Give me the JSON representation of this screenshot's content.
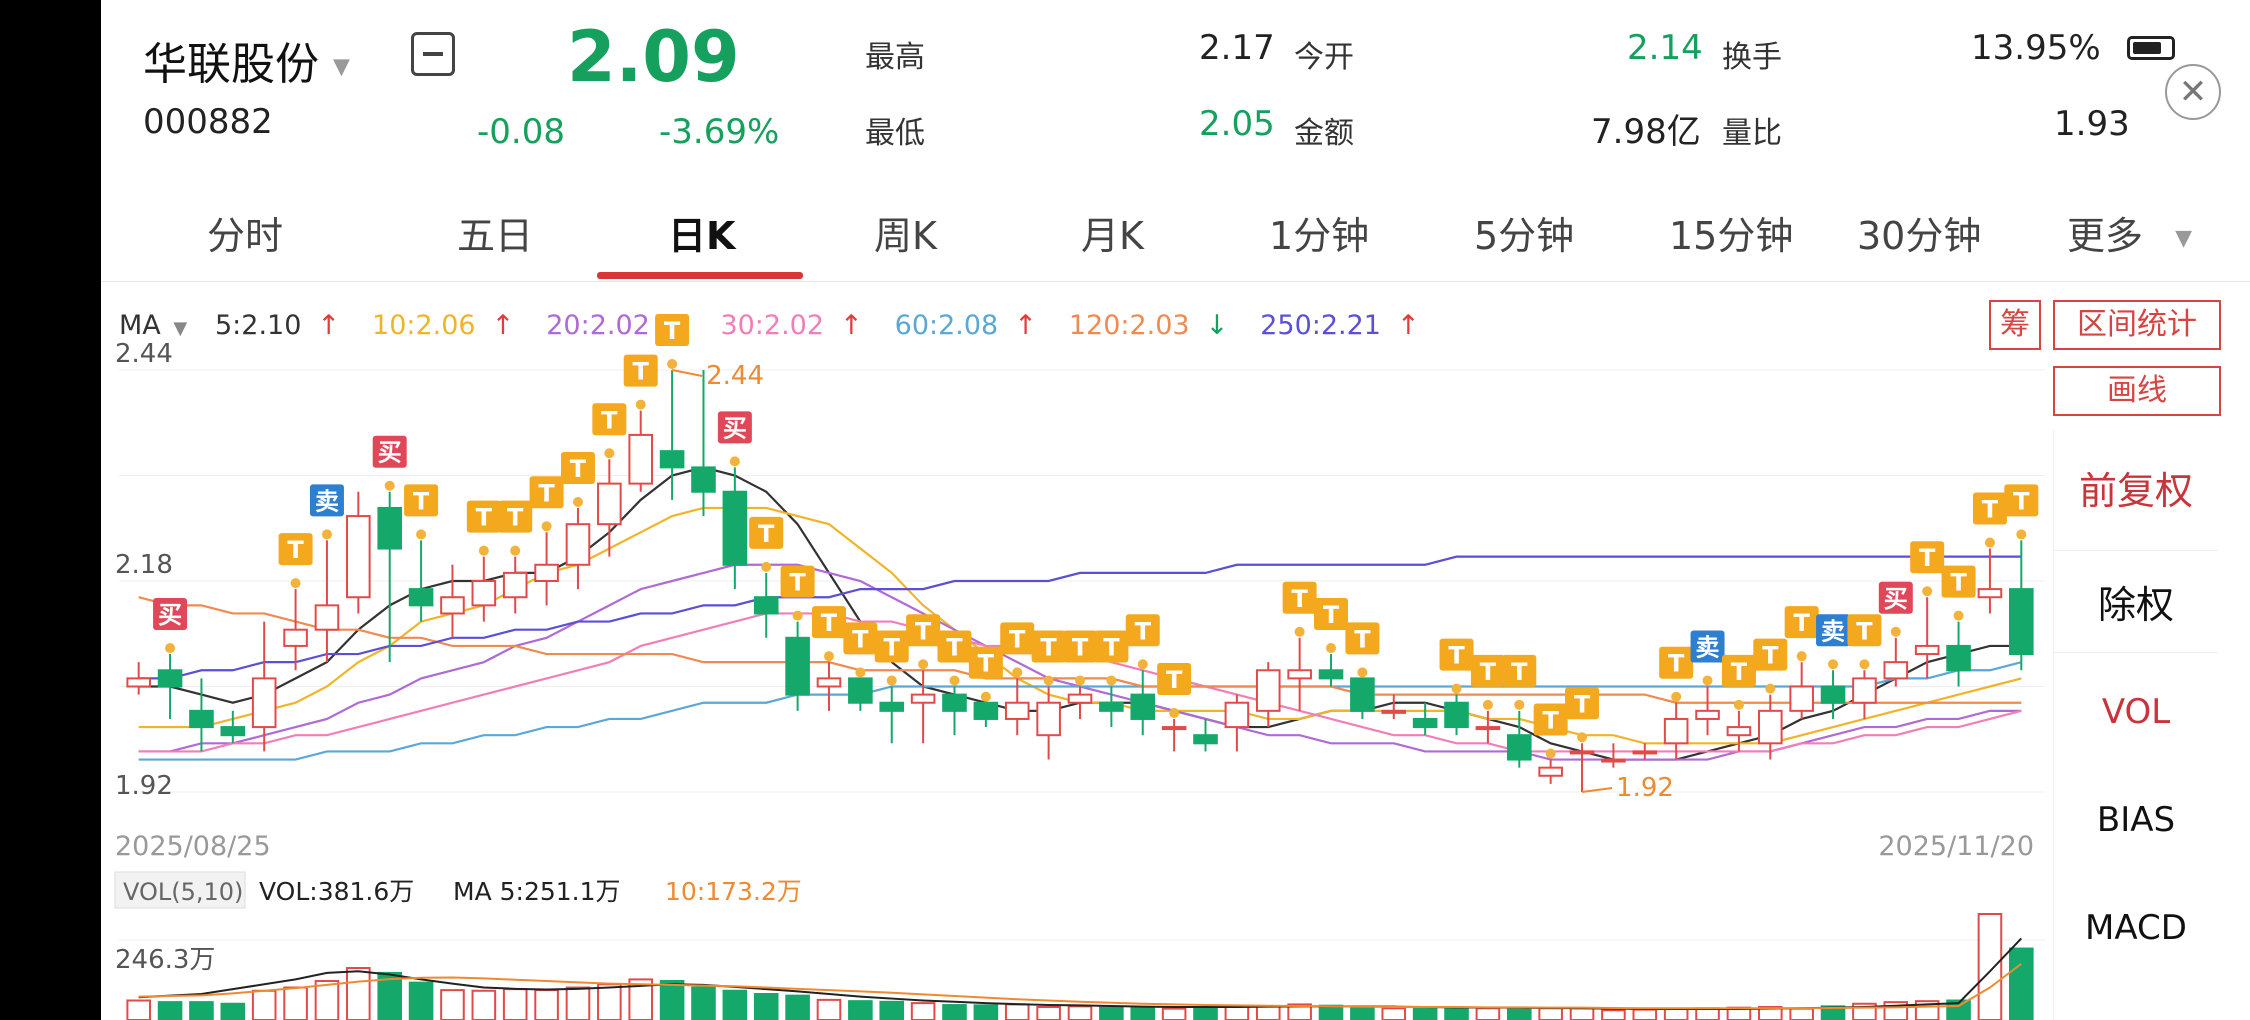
{
  "status": {
    "battery": "13.95%"
  },
  "header": {
    "stock_name": "华联股份",
    "stock_code": "000882",
    "price": "2.09",
    "change": "-0.08",
    "change_pct": "-3.69%",
    "stats": [
      {
        "label": "最高",
        "value": "2.17"
      },
      {
        "label": "今开",
        "value": "2.14"
      },
      {
        "label": "换手",
        "value": "13.95%"
      },
      {
        "label": "最低",
        "value": "2.05"
      },
      {
        "label": "金额",
        "value": "7.98亿"
      },
      {
        "label": "量比",
        "value": "1.93"
      }
    ]
  },
  "tabs": [
    "分时",
    "五日",
    "日K",
    "周K",
    "月K",
    "1分钟",
    "5分钟",
    "15分钟",
    "30分钟",
    "更多"
  ],
  "active_tab": "日K",
  "ma_legend": {
    "title": "MA",
    "items": [
      {
        "text": "5:2.10",
        "arrow": "↑",
        "color": "#333333"
      },
      {
        "text": "10:2.06",
        "arrow": "↑",
        "color": "#f0b429"
      },
      {
        "text": "20:2.02",
        "arrow": "↑",
        "color": "#b06ad6"
      },
      {
        "text": "30:2.02",
        "arrow": "↑",
        "color": "#f07fb8"
      },
      {
        "text": "60:2.08",
        "arrow": "↑",
        "color": "#5aa7d8"
      },
      {
        "text": "120:2.03",
        "arrow": "↓",
        "color": "#ef8a50"
      },
      {
        "text": "250:2.21",
        "arrow": "↑",
        "color": "#5a4fd6"
      }
    ]
  },
  "side_panel": {
    "chip_button": "筹",
    "range_stats_button": "区间统计",
    "draw_button": "画线",
    "items": [
      "前复权",
      "除权",
      "VOL",
      "BIAS",
      "MACD"
    ]
  },
  "chart": {
    "y_labels": [
      "2.44",
      "2.18",
      "1.92"
    ],
    "high_marker": "2.44",
    "low_marker": "1.92",
    "x_start": "2025/08/25",
    "x_end": "2025/11/20",
    "vol_title": "VOL(5,10)",
    "vol_values": [
      {
        "text": "VOL:381.6万",
        "color": "#222222"
      },
      {
        "text": "MA 5:251.1万",
        "color": "#222222"
      },
      {
        "text": "10:173.2万",
        "color": "#ef8a30"
      }
    ],
    "vol_axis": "246.3万",
    "buy_label": "买",
    "sell_label": "卖",
    "t_label": "T"
  },
  "chart_data": {
    "type": "candlestick",
    "ylim": [
      1.92,
      2.44
    ],
    "start_date": "2025/08/25",
    "end_date": "2025/11/20",
    "candles": [
      [
        2.05,
        2.06,
        2.08,
        2.04
      ],
      [
        2.07,
        2.05,
        2.09,
        2.01
      ],
      [
        2.02,
        2.0,
        2.06,
        1.97
      ],
      [
        2.0,
        1.99,
        2.02,
        1.98
      ],
      [
        2.0,
        2.06,
        2.13,
        1.97
      ],
      [
        2.1,
        2.12,
        2.17,
        2.07
      ],
      [
        2.12,
        2.15,
        2.23,
        2.08
      ],
      [
        2.16,
        2.26,
        2.29,
        2.14
      ],
      [
        2.27,
        2.22,
        2.29,
        2.08
      ],
      [
        2.17,
        2.15,
        2.23,
        2.13
      ],
      [
        2.14,
        2.16,
        2.2,
        2.11
      ],
      [
        2.15,
        2.18,
        2.21,
        2.13
      ],
      [
        2.16,
        2.19,
        2.21,
        2.14
      ],
      [
        2.18,
        2.2,
        2.24,
        2.15
      ],
      [
        2.2,
        2.25,
        2.27,
        2.17
      ],
      [
        2.25,
        2.3,
        2.33,
        2.21
      ],
      [
        2.3,
        2.36,
        2.39,
        2.29
      ],
      [
        2.34,
        2.32,
        2.44,
        2.28
      ],
      [
        2.32,
        2.29,
        2.44,
        2.26
      ],
      [
        2.29,
        2.2,
        2.32,
        2.17
      ],
      [
        2.16,
        2.14,
        2.19,
        2.11
      ],
      [
        2.11,
        2.04,
        2.13,
        2.02
      ],
      [
        2.05,
        2.06,
        2.08,
        2.02
      ],
      [
        2.06,
        2.03,
        2.06,
        2.02
      ],
      [
        2.03,
        2.02,
        2.05,
        1.98
      ],
      [
        2.03,
        2.04,
        2.07,
        1.98
      ],
      [
        2.04,
        2.02,
        2.05,
        1.99
      ],
      [
        2.03,
        2.01,
        2.03,
        2.0
      ],
      [
        2.01,
        2.03,
        2.06,
        1.99
      ],
      [
        1.99,
        2.03,
        2.05,
        1.96
      ],
      [
        2.03,
        2.04,
        2.05,
        2.01
      ],
      [
        2.03,
        2.02,
        2.05,
        2.0
      ],
      [
        2.04,
        2.01,
        2.07,
        1.99
      ],
      [
        2.0,
        2.0,
        2.01,
        1.97
      ],
      [
        1.99,
        1.98,
        2.01,
        1.97
      ],
      [
        2.0,
        2.03,
        2.04,
        1.97
      ],
      [
        2.02,
        2.07,
        2.08,
        2.0
      ],
      [
        2.06,
        2.07,
        2.11,
        2.02
      ],
      [
        2.07,
        2.06,
        2.09,
        2.05
      ],
      [
        2.06,
        2.02,
        2.06,
        2.01
      ],
      [
        2.02,
        2.02,
        2.04,
        2.01
      ],
      [
        2.01,
        2.0,
        2.03,
        1.99
      ],
      [
        2.03,
        2.0,
        2.04,
        1.99
      ],
      [
        2.0,
        2.0,
        2.02,
        1.98
      ],
      [
        1.99,
        1.96,
        2.02,
        1.95
      ],
      [
        1.94,
        1.95,
        1.96,
        1.93
      ],
      [
        1.97,
        1.97,
        1.98,
        1.92
      ],
      [
        1.96,
        1.96,
        1.98,
        1.95
      ],
      [
        1.97,
        1.97,
        1.98,
        1.96
      ],
      [
        1.98,
        2.01,
        2.03,
        1.96
      ],
      [
        2.01,
        2.02,
        2.05,
        1.99
      ],
      [
        1.99,
        2.0,
        2.02,
        1.97
      ],
      [
        1.98,
        2.02,
        2.04,
        1.96
      ],
      [
        2.02,
        2.05,
        2.08,
        2.01
      ],
      [
        2.05,
        2.03,
        2.07,
        2.01
      ],
      [
        2.03,
        2.06,
        2.07,
        2.01
      ],
      [
        2.06,
        2.08,
        2.11,
        2.05
      ],
      [
        2.09,
        2.1,
        2.16,
        2.06
      ],
      [
        2.1,
        2.07,
        2.13,
        2.05
      ],
      [
        2.16,
        2.17,
        2.22,
        2.14
      ],
      [
        2.17,
        2.09,
        2.23,
        2.07
      ]
    ],
    "volume": [
      60,
      55,
      55,
      50,
      90,
      100,
      120,
      160,
      145,
      115,
      92,
      90,
      95,
      92,
      100,
      110,
      125,
      120,
      100,
      90,
      80,
      75,
      62,
      58,
      56,
      52,
      46,
      45,
      48,
      40,
      42,
      38,
      38,
      35,
      40,
      44,
      42,
      48,
      44,
      38,
      36,
      37,
      35,
      36,
      38,
      36,
      36,
      30,
      32,
      34,
      36,
      38,
      40,
      35,
      42,
      50,
      55,
      58,
      60,
      381.6,
      220
    ],
    "vol_scale_max": 246.3,
    "vol_axis_level": 246.3,
    "ma_lines": [
      {
        "name": "MA5",
        "color": "#333333",
        "values": [
          2.05,
          2.05,
          2.04,
          2.03,
          2.04,
          2.06,
          2.08,
          2.12,
          2.15,
          2.17,
          2.18,
          2.18,
          2.19,
          2.19,
          2.21,
          2.24,
          2.28,
          2.31,
          2.32,
          2.31,
          2.29,
          2.25,
          2.19,
          2.13,
          2.08,
          2.05,
          2.04,
          2.03,
          2.02,
          2.02,
          2.03,
          2.03,
          2.03,
          2.02,
          2.01,
          2.0,
          2.0,
          2.01,
          2.02,
          2.02,
          2.03,
          2.03,
          2.02,
          2.01,
          2.0,
          1.98,
          1.97,
          1.96,
          1.96,
          1.96,
          1.97,
          1.98,
          1.99,
          2.01,
          2.02,
          2.04,
          2.06,
          2.08,
          2.09,
          2.1,
          2.1
        ]
      },
      {
        "name": "MA10",
        "color": "#f0b429",
        "values": [
          2.0,
          2.0,
          2.0,
          2.01,
          2.02,
          2.03,
          2.05,
          2.08,
          2.1,
          2.13,
          2.14,
          2.15,
          2.17,
          2.19,
          2.2,
          2.22,
          2.24,
          2.26,
          2.27,
          2.27,
          2.27,
          2.26,
          2.25,
          2.22,
          2.19,
          2.15,
          2.12,
          2.09,
          2.06,
          2.04,
          2.03,
          2.03,
          2.02,
          2.02,
          2.02,
          2.02,
          2.01,
          2.01,
          2.02,
          2.02,
          2.02,
          2.02,
          2.02,
          2.01,
          2.01,
          2.0,
          1.99,
          1.99,
          1.98,
          1.98,
          1.98,
          1.98,
          1.98,
          1.99,
          2.0,
          2.01,
          2.02,
          2.03,
          2.04,
          2.05,
          2.06
        ]
      },
      {
        "name": "MA20",
        "color": "#b06ad6",
        "values": [
          1.97,
          1.97,
          1.98,
          1.98,
          1.99,
          2.0,
          2.01,
          2.03,
          2.04,
          2.06,
          2.07,
          2.08,
          2.1,
          2.11,
          2.13,
          2.15,
          2.17,
          2.18,
          2.19,
          2.2,
          2.2,
          2.2,
          2.19,
          2.18,
          2.16,
          2.14,
          2.12,
          2.1,
          2.08,
          2.06,
          2.05,
          2.04,
          2.03,
          2.02,
          2.01,
          2.0,
          1.99,
          1.99,
          1.98,
          1.98,
          1.98,
          1.97,
          1.97,
          1.97,
          1.97,
          1.96,
          1.96,
          1.96,
          1.96,
          1.96,
          1.96,
          1.97,
          1.97,
          1.98,
          1.99,
          2.0,
          2.0,
          2.01,
          2.01,
          2.02,
          2.02
        ]
      },
      {
        "name": "MA30",
        "color": "#f07fb8",
        "values": [
          1.97,
          1.97,
          1.97,
          1.98,
          1.98,
          1.99,
          1.99,
          2.0,
          2.01,
          2.02,
          2.03,
          2.04,
          2.05,
          2.06,
          2.07,
          2.08,
          2.1,
          2.11,
          2.12,
          2.13,
          2.14,
          2.14,
          2.14,
          2.13,
          2.13,
          2.12,
          2.11,
          2.1,
          2.1,
          2.09,
          2.09,
          2.08,
          2.07,
          2.06,
          2.05,
          2.04,
          2.03,
          2.02,
          2.01,
          2.0,
          1.99,
          1.99,
          1.98,
          1.98,
          1.97,
          1.97,
          1.97,
          1.97,
          1.97,
          1.97,
          1.97,
          1.97,
          1.97,
          1.98,
          1.98,
          1.99,
          1.99,
          2.0,
          2.0,
          2.01,
          2.02
        ]
      },
      {
        "name": "MA60",
        "color": "#5aa7d8",
        "values": [
          1.96,
          1.96,
          1.96,
          1.96,
          1.96,
          1.96,
          1.97,
          1.97,
          1.97,
          1.98,
          1.98,
          1.99,
          1.99,
          2.0,
          2.0,
          2.01,
          2.01,
          2.02,
          2.03,
          2.03,
          2.03,
          2.04,
          2.04,
          2.04,
          2.05,
          2.05,
          2.05,
          2.05,
          2.05,
          2.05,
          2.05,
          2.05,
          2.05,
          2.05,
          2.05,
          2.05,
          2.05,
          2.05,
          2.05,
          2.05,
          2.05,
          2.05,
          2.05,
          2.05,
          2.05,
          2.05,
          2.05,
          2.05,
          2.05,
          2.05,
          2.05,
          2.05,
          2.05,
          2.05,
          2.05,
          2.05,
          2.06,
          2.06,
          2.07,
          2.07,
          2.08
        ]
      },
      {
        "name": "MA120",
        "color": "#ef8a50",
        "values": [
          2.16,
          2.15,
          2.15,
          2.14,
          2.14,
          2.13,
          2.12,
          2.12,
          2.11,
          2.11,
          2.1,
          2.1,
          2.1,
          2.09,
          2.09,
          2.09,
          2.09,
          2.09,
          2.08,
          2.08,
          2.08,
          2.08,
          2.08,
          2.07,
          2.07,
          2.07,
          2.07,
          2.06,
          2.06,
          2.06,
          2.06,
          2.06,
          2.05,
          2.05,
          2.05,
          2.05,
          2.05,
          2.05,
          2.05,
          2.04,
          2.04,
          2.04,
          2.04,
          2.04,
          2.04,
          2.04,
          2.04,
          2.04,
          2.04,
          2.03,
          2.03,
          2.03,
          2.03,
          2.03,
          2.03,
          2.03,
          2.03,
          2.03,
          2.03,
          2.03,
          2.03
        ]
      },
      {
        "name": "MA250",
        "color": "#5a4fd6",
        "values": [
          2.06,
          2.06,
          2.07,
          2.07,
          2.08,
          2.08,
          2.09,
          2.09,
          2.1,
          2.1,
          2.11,
          2.11,
          2.12,
          2.12,
          2.13,
          2.13,
          2.14,
          2.14,
          2.15,
          2.15,
          2.16,
          2.16,
          2.16,
          2.17,
          2.17,
          2.17,
          2.18,
          2.18,
          2.18,
          2.18,
          2.19,
          2.19,
          2.19,
          2.19,
          2.19,
          2.2,
          2.2,
          2.2,
          2.2,
          2.2,
          2.2,
          2.2,
          2.21,
          2.21,
          2.21,
          2.21,
          2.21,
          2.21,
          2.21,
          2.21,
          2.21,
          2.21,
          2.21,
          2.21,
          2.21,
          2.21,
          2.21,
          2.21,
          2.21,
          2.21,
          2.21
        ]
      }
    ],
    "vol_ma5": [
      70,
      75,
      80,
      95,
      110,
      125,
      145,
      150,
      140,
      125,
      112,
      100,
      96,
      94,
      96,
      100,
      105,
      110,
      108,
      102,
      95,
      88,
      80,
      72,
      66,
      60,
      56,
      52,
      49,
      46,
      45,
      43,
      41,
      40,
      40,
      40,
      41,
      42,
      42,
      42,
      41,
      40,
      39,
      38,
      38,
      37,
      36,
      35,
      34,
      34,
      34,
      34,
      35,
      36,
      38,
      40,
      44,
      48,
      52,
      150,
      251.1
    ],
    "vol_ma10": [
      72,
      74,
      76,
      82,
      90,
      98,
      108,
      118,
      126,
      130,
      131,
      128,
      124,
      120,
      116,
      112,
      110,
      108,
      106,
      104,
      100,
      96,
      92,
      88,
      84,
      79,
      74,
      69,
      64,
      60,
      56,
      53,
      50,
      48,
      46,
      45,
      44,
      43,
      42,
      41,
      40,
      40,
      40,
      39,
      39,
      38,
      38,
      37,
      36,
      36,
      36,
      36,
      36,
      36,
      37,
      38,
      39,
      41,
      43,
      100,
      173.2
    ],
    "markers": [
      {
        "i": 1,
        "type": "buy"
      },
      {
        "i": 5,
        "type": "T"
      },
      {
        "i": 6,
        "type": "sell"
      },
      {
        "i": 8,
        "type": "buy"
      },
      {
        "i": 9,
        "type": "T"
      },
      {
        "i": 11,
        "type": "T"
      },
      {
        "i": 12,
        "type": "T"
      },
      {
        "i": 13,
        "type": "T"
      },
      {
        "i": 14,
        "type": "T"
      },
      {
        "i": 15,
        "type": "T"
      },
      {
        "i": 16,
        "type": "T"
      },
      {
        "i": 17,
        "type": "T"
      },
      {
        "i": 19,
        "type": "buy"
      },
      {
        "i": 20,
        "type": "T"
      },
      {
        "i": 21,
        "type": "T"
      },
      {
        "i": 22,
        "type": "T"
      },
      {
        "i": 23,
        "type": "T"
      },
      {
        "i": 24,
        "type": "T"
      },
      {
        "i": 25,
        "type": "T"
      },
      {
        "i": 26,
        "type": "T"
      },
      {
        "i": 27,
        "type": "T"
      },
      {
        "i": 28,
        "type": "T"
      },
      {
        "i": 29,
        "type": "T"
      },
      {
        "i": 30,
        "type": "T"
      },
      {
        "i": 31,
        "type": "T"
      },
      {
        "i": 32,
        "type": "T"
      },
      {
        "i": 33,
        "type": "T"
      },
      {
        "i": 37,
        "type": "T"
      },
      {
        "i": 38,
        "type": "T"
      },
      {
        "i": 39,
        "type": "T"
      },
      {
        "i": 42,
        "type": "T"
      },
      {
        "i": 43,
        "type": "T"
      },
      {
        "i": 44,
        "type": "T"
      },
      {
        "i": 45,
        "type": "T"
      },
      {
        "i": 46,
        "type": "T"
      },
      {
        "i": 49,
        "type": "T"
      },
      {
        "i": 50,
        "type": "sell"
      },
      {
        "i": 51,
        "type": "T"
      },
      {
        "i": 52,
        "type": "T"
      },
      {
        "i": 53,
        "type": "T"
      },
      {
        "i": 54,
        "type": "sell"
      },
      {
        "i": 55,
        "type": "T"
      },
      {
        "i": 56,
        "type": "buy"
      },
      {
        "i": 57,
        "type": "T"
      },
      {
        "i": 58,
        "type": "T"
      },
      {
        "i": 59,
        "type": "T"
      },
      {
        "i": 60,
        "type": "T"
      }
    ]
  }
}
